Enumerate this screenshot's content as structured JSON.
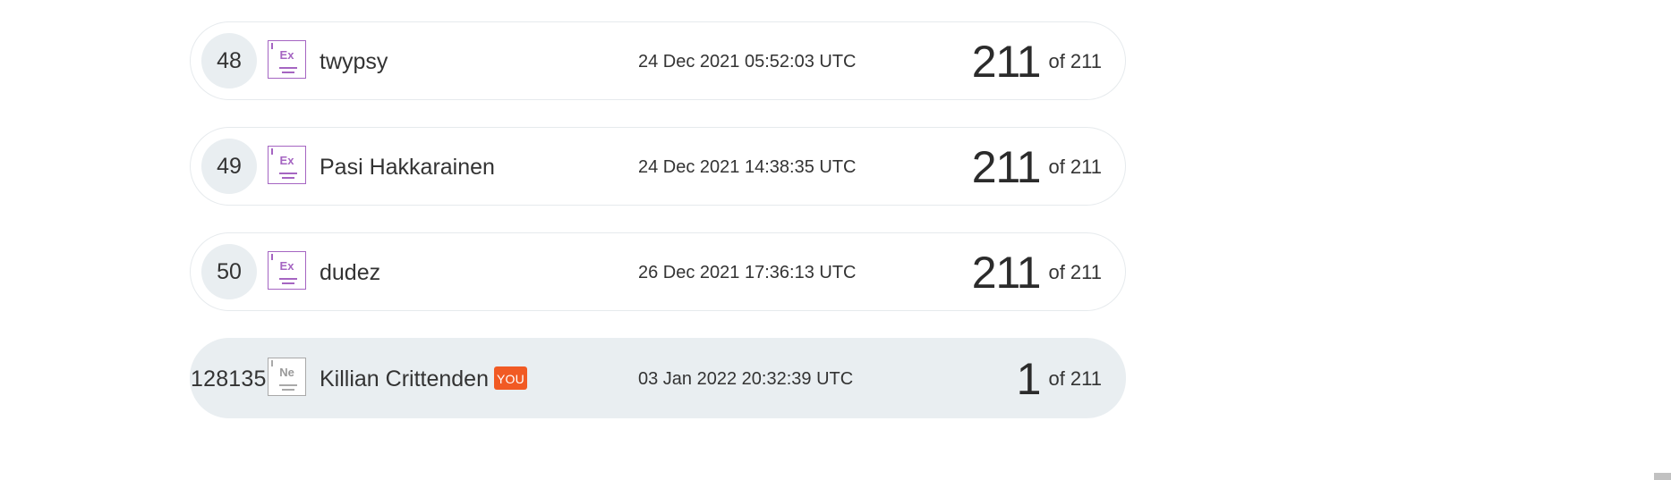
{
  "leaderboard": {
    "rows": [
      {
        "rank": "48",
        "badge_symbol": "Ex",
        "badge_icon": "element-badge-icon",
        "name": "twypsy",
        "timestamp": "24 Dec 2021 05:52:03 UTC",
        "score": "211",
        "total": "of 211"
      },
      {
        "rank": "49",
        "badge_symbol": "Ex",
        "badge_icon": "element-badge-icon",
        "name": "Pasi Hakkarainen",
        "timestamp": "24 Dec 2021 14:38:35 UTC",
        "score": "211",
        "total": "of 211"
      },
      {
        "rank": "50",
        "badge_symbol": "Ex",
        "badge_icon": "element-badge-icon",
        "name": "dudez",
        "timestamp": "26 Dec 2021 17:36:13 UTC",
        "score": "211",
        "total": "of 211"
      },
      {
        "rank": "128135",
        "badge_symbol": "Ne",
        "badge_icon": "element-badge-icon",
        "name": "Killian Crittenden",
        "you_label": "YOU",
        "timestamp": "03 Jan 2022 20:32:39 UTC",
        "score": "1",
        "total": "of 211"
      }
    ]
  },
  "colors": {
    "row_border": "#e6eaed",
    "highlight_bg": "#e9eef1",
    "badge_purple": "#a565c2",
    "badge_gray": "#a9a9a9",
    "you_tag": "#f15a24"
  }
}
